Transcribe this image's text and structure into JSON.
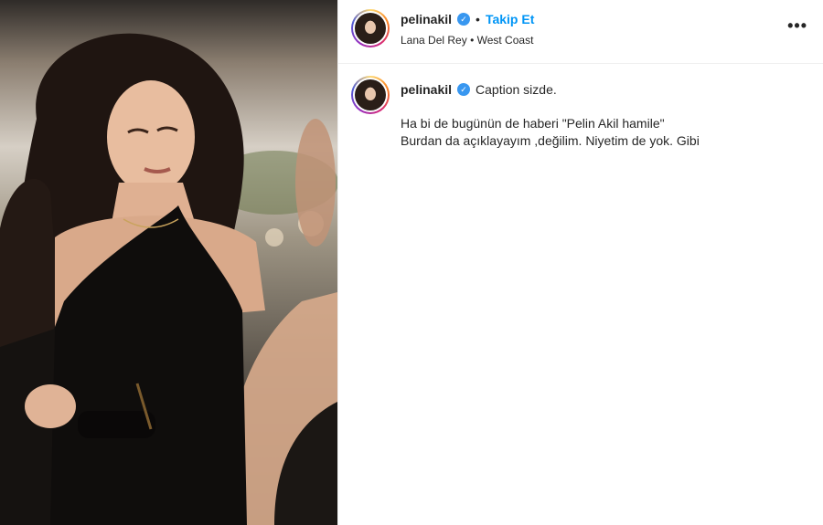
{
  "post": {
    "username": "pelinakil",
    "verified_icon": "verified-badge-icon",
    "separator": "•",
    "follow_label": "Takip Et",
    "audio": "Lana Del Rey",
    "location_sep": "•",
    "location": "West Coast",
    "more_label": "•••"
  },
  "caption": {
    "username": "pelinakil",
    "text": "Caption sizde.",
    "body_lines": [
      "Ha bi de bugünün de haberi \"Pelin Akil hamile\"",
      "Burdan da açıklayayım ,değilim. Niyetim de yok. Gibi"
    ]
  },
  "colors": {
    "accent": "#0095f6",
    "verified": "#3897f0",
    "text": "#262626",
    "border": "#efefef"
  }
}
